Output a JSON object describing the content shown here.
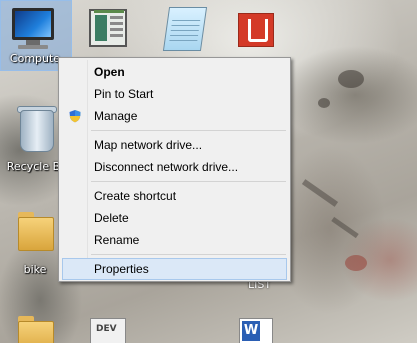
{
  "desktop": {
    "icons": {
      "computer": "Compute",
      "recycle_bin": "Recycle Bi",
      "bike": "bike",
      "list": "LIST",
      "doc_text": "DEV"
    }
  },
  "context_menu": {
    "items": [
      {
        "label": "Open"
      },
      {
        "label": "Pin to Start"
      },
      {
        "label": "Manage",
        "icon": "uac-shield-icon"
      },
      {
        "label": "Map network drive..."
      },
      {
        "label": "Disconnect network drive..."
      },
      {
        "label": "Create shortcut"
      },
      {
        "label": "Delete"
      },
      {
        "label": "Rename"
      },
      {
        "label": "Properties"
      }
    ],
    "highlight_color": "#dbe8f7"
  }
}
